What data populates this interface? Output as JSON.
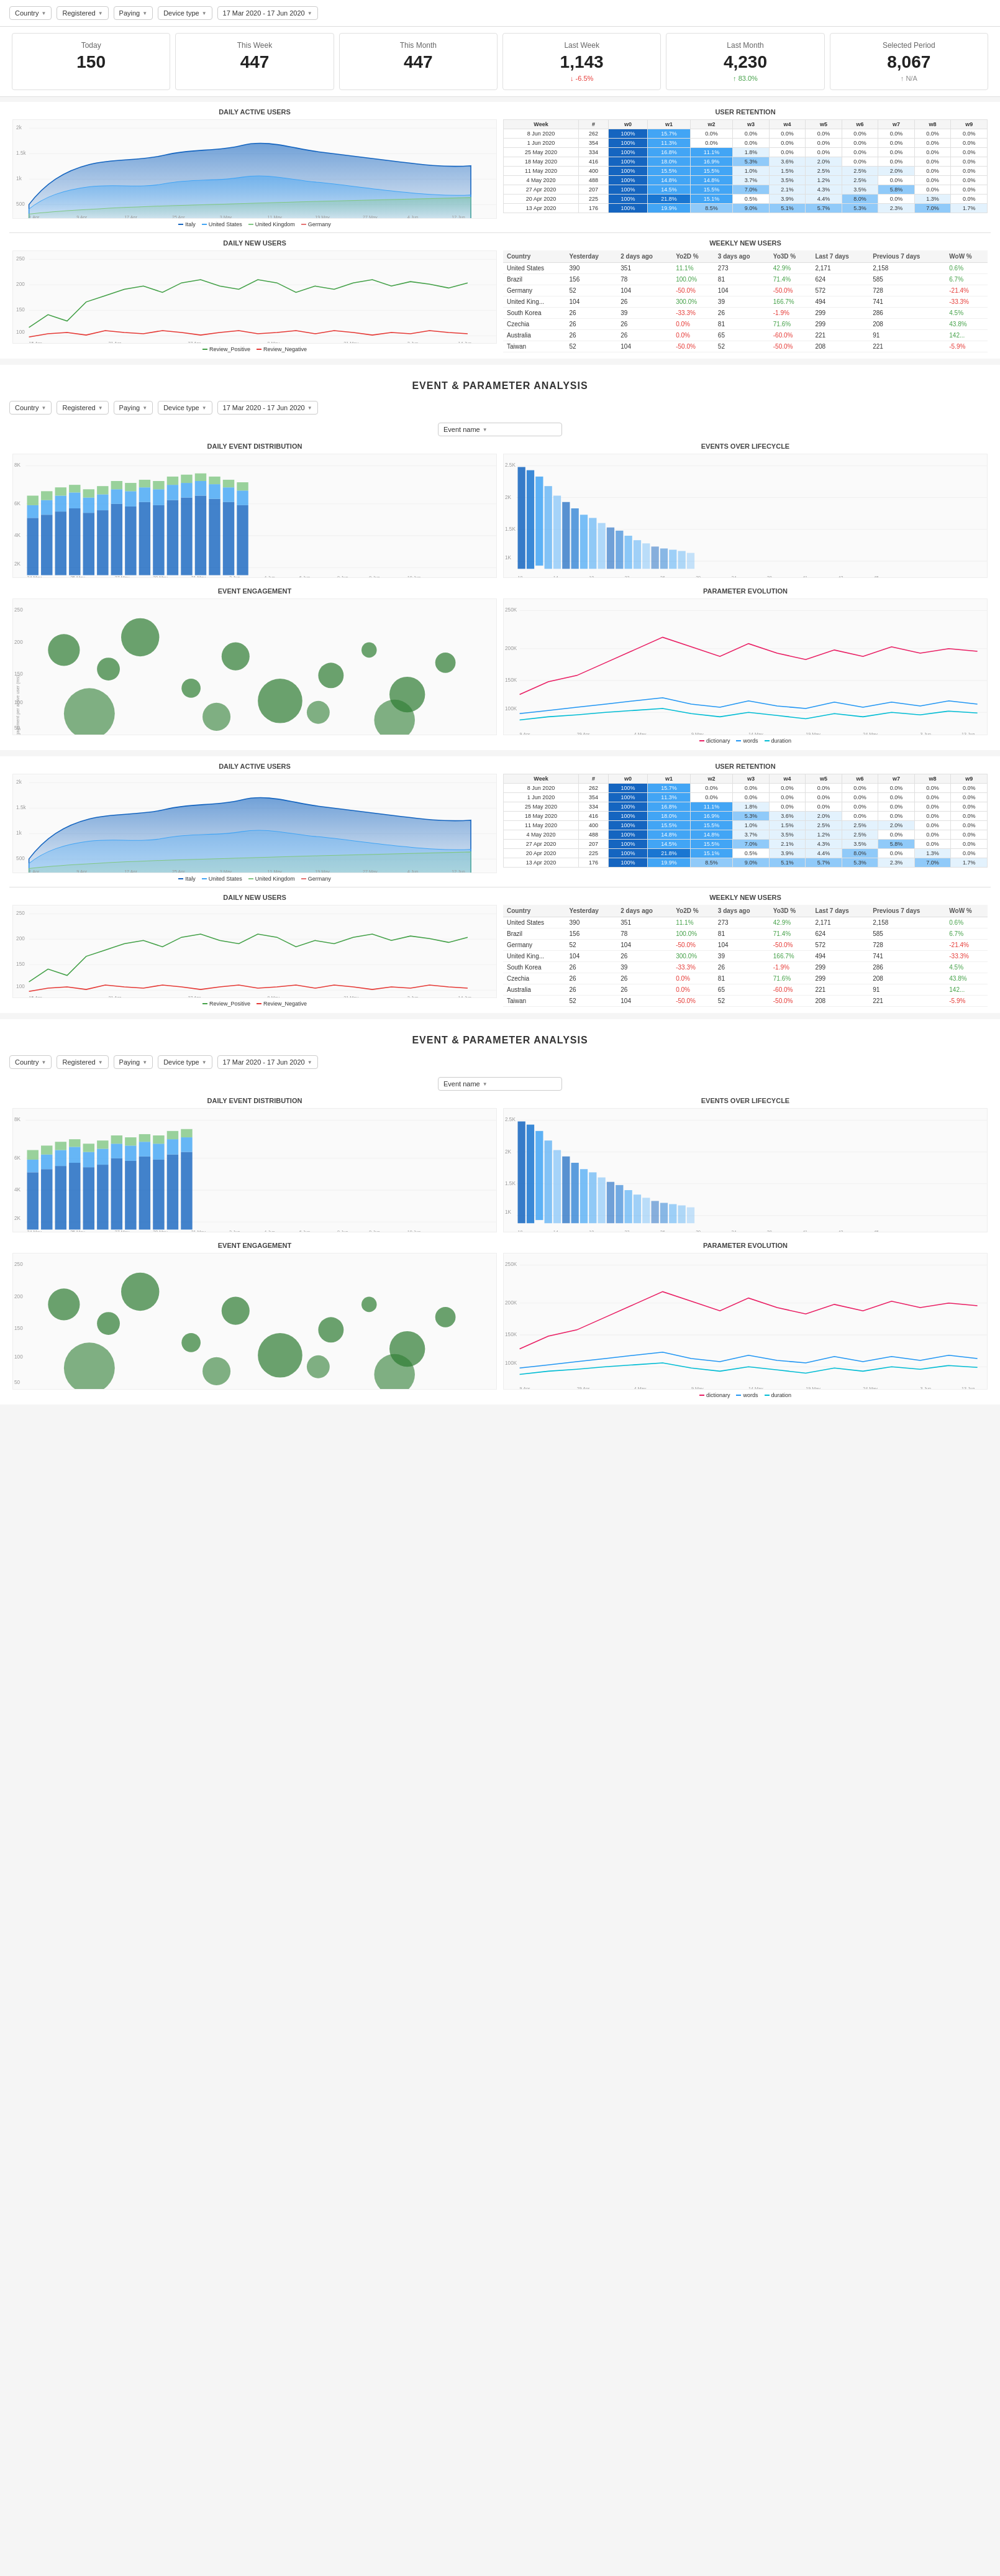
{
  "filters": {
    "country_label": "Country",
    "registered_label": "Registered",
    "paying_label": "Paying",
    "device_type_label": "Device type",
    "date_range": "17 Mar 2020 - 17 Jun 2020"
  },
  "stats": {
    "today": {
      "label": "Today",
      "value": "150"
    },
    "this_week": {
      "label": "This Week",
      "value": "447"
    },
    "this_month": {
      "label": "This Month",
      "value": "447"
    },
    "last_week": {
      "label": "Last Week",
      "value": "1,143",
      "change": "↓ -6.5%",
      "change_type": "negative"
    },
    "last_month": {
      "label": "Last Month",
      "value": "4,230",
      "change": "↑ 83.0%",
      "change_type": "positive"
    },
    "selected_period": {
      "label": "Selected Period",
      "value": "8,067",
      "change": "↑ N/A",
      "change_type": "neutral"
    }
  },
  "daily_active_users_title": "DAILY ACTIVE USERS",
  "user_retention_title": "USER RETENTION",
  "daily_new_users_title": "DAILY NEW USERS",
  "weekly_new_users_title": "WEEKLY NEW USERS",
  "event_analysis_title": "EVENT & PARAMETER ANALYSIS",
  "daily_event_dist_title": "DAILY EVENT DISTRIBUTION",
  "events_lifecycle_title": "EVENTS OVER LIFECYCLE",
  "event_engagement_title": "EVENT ENGAGEMENT",
  "parameter_evolution_title": "PARAMETER EVOLUTION",
  "retention_headers": [
    "Week",
    "#",
    "w0",
    "w1",
    "w2",
    "w3",
    "w4",
    "w5",
    "w6",
    "w7",
    "w8",
    "w9"
  ],
  "retention_rows": [
    {
      "week": "8 Jun 2020",
      "n": "262",
      "w0": "100%",
      "w1": "15.7%",
      "w2": "0.0%",
      "w3": "0.0%",
      "w4": "0.0%",
      "w5": "0.0%",
      "w6": "0.0%",
      "w7": "0.0%",
      "w8": "0.0%",
      "w9": "0.0%"
    },
    {
      "week": "1 Jun 2020",
      "n": "354",
      "w0": "100%",
      "w1": "11.3%",
      "w2": "0.0%",
      "w3": "0.0%",
      "w4": "0.0%",
      "w5": "0.0%",
      "w6": "0.0%",
      "w7": "0.0%",
      "w8": "0.0%",
      "w9": "0.0%"
    },
    {
      "week": "25 May 2020",
      "n": "334",
      "w0": "100%",
      "w1": "16.8%",
      "w2": "11.1%",
      "w3": "1.8%",
      "w4": "0.0%",
      "w5": "0.0%",
      "w6": "0.0%",
      "w7": "0.0%",
      "w8": "0.0%",
      "w9": "0.0%"
    },
    {
      "week": "18 May 2020",
      "n": "416",
      "w0": "100%",
      "w1": "18.0%",
      "w2": "16.9%",
      "w3": "5.3%",
      "w4": "3.6%",
      "w5": "2.0%",
      "w6": "0.0%",
      "w7": "0.0%",
      "w8": "0.0%",
      "w9": "0.0%"
    },
    {
      "week": "11 May 2020",
      "n": "400",
      "w0": "100%",
      "w1": "15.5%",
      "w2": "15.5%",
      "w3": "1.0%",
      "w4": "1.5%",
      "w5": "2.5%",
      "w6": "2.5%",
      "w7": "2.0%",
      "w8": "0.0%",
      "w9": "0.0%"
    },
    {
      "week": "4 May 2020",
      "n": "488",
      "w0": "100%",
      "w1": "14.8%",
      "w2": "14.8%",
      "w3": "3.7%",
      "w4": "3.5%",
      "w5": "1.2%",
      "w6": "2.5%",
      "w7": "0.0%",
      "w8": "0.0%",
      "w9": "0.0%"
    },
    {
      "week": "27 Apr 2020",
      "n": "207",
      "w0": "100%",
      "w1": "14.5%",
      "w2": "15.5%",
      "w3": "7.0%",
      "w4": "2.1%",
      "w5": "4.3%",
      "w6": "3.5%",
      "w7": "5.8%",
      "w8": "0.0%",
      "w9": "0.0%"
    },
    {
      "week": "20 Apr 2020",
      "n": "225",
      "w0": "100%",
      "w1": "21.8%",
      "w2": "15.1%",
      "w3": "0.5%",
      "w4": "3.9%",
      "w5": "4.4%",
      "w6": "8.0%",
      "w7": "0.0%",
      "w8": "1.3%",
      "w9": "0.0%"
    },
    {
      "week": "13 Apr 2020",
      "n": "176",
      "w0": "100%",
      "w1": "19.9%",
      "w2": "8.5%",
      "w3": "9.0%",
      "w4": "5.1%",
      "w5": "5.7%",
      "w6": "5.3%",
      "w7": "2.3%",
      "w8": "7.0%",
      "w9": "1.7%"
    }
  ],
  "weekly_new_users_headers": [
    "Country",
    "Yesterday",
    "2 days ago",
    "Yol2D %",
    "3 days ago",
    "Yo3D %",
    "Last 7 days",
    "Previous 7 days",
    "WoW %"
  ],
  "weekly_new_users_rows": [
    {
      "country": "United States",
      "y": "390",
      "d2": "351",
      "yo2": "11.1%",
      "d3": "273",
      "yo3": "42.9%",
      "l7": "2,171",
      "p7": "2,158",
      "wow": "0.6%",
      "yo2_pos": true,
      "yo3_pos": true,
      "wow_pos": true
    },
    {
      "country": "Brazil",
      "y": "156",
      "d2": "78",
      "yo2": "100.0%",
      "d3": "81",
      "yo3": "71.4%",
      "l7": "624",
      "p7": "585",
      "wow": "6.7%",
      "yo2_pos": true,
      "yo3_pos": true,
      "wow_pos": true
    },
    {
      "country": "Germany",
      "y": "52",
      "d2": "104",
      "yo2": "-50.0%",
      "d3": "104",
      "yo3": "-50.0%",
      "l7": "572",
      "p7": "728",
      "wow": "-21.4%",
      "yo2_pos": false,
      "yo3_pos": false,
      "wow_pos": false
    },
    {
      "country": "United King...",
      "y": "104",
      "d2": "26",
      "yo2": "300.0%",
      "d3": "39",
      "yo3": "166.7%",
      "l7": "494",
      "p7": "741",
      "wow": "-33.3%",
      "yo2_pos": true,
      "yo3_pos": true,
      "wow_pos": false
    },
    {
      "country": "South Korea",
      "y": "26",
      "d2": "39",
      "yo2": "-33.3%",
      "d3": "26",
      "yo3": "-1.9%",
      "l7": "299",
      "p7": "286",
      "wow": "4.5%",
      "yo2_pos": false,
      "yo3_pos": false,
      "wow_pos": true
    },
    {
      "country": "Czechia",
      "y": "26",
      "d2": "26",
      "yo2": "0.0%",
      "d3": "81",
      "yo3": "71.6%",
      "l7": "299",
      "p7": "208",
      "wow": "43.8%",
      "yo2_pos": false,
      "yo3_pos": true,
      "wow_pos": true
    },
    {
      "country": "Australia",
      "y": "26",
      "d2": "26",
      "yo2": "0.0%",
      "d3": "65",
      "yo3": "-60.0%",
      "l7": "221",
      "p7": "91",
      "wow": "142...",
      "yo2_pos": false,
      "yo3_pos": false,
      "wow_pos": true
    },
    {
      "country": "Taiwan",
      "y": "52",
      "d2": "104",
      "yo2": "-50.0%",
      "d3": "52",
      "yo3": "-50.0%",
      "l7": "208",
      "p7": "221",
      "wow": "-5.9%",
      "yo2_pos": false,
      "yo3_pos": false,
      "wow_pos": false
    }
  ],
  "event_name_placeholder": "Event name",
  "legend_daily": [
    "Italy",
    "United States",
    "United Kingdom",
    "Germany"
  ],
  "legend_new_users": [
    "Review_Positive",
    "Review_Negative"
  ],
  "legend_param": [
    "dictionary",
    "words",
    "duration"
  ]
}
